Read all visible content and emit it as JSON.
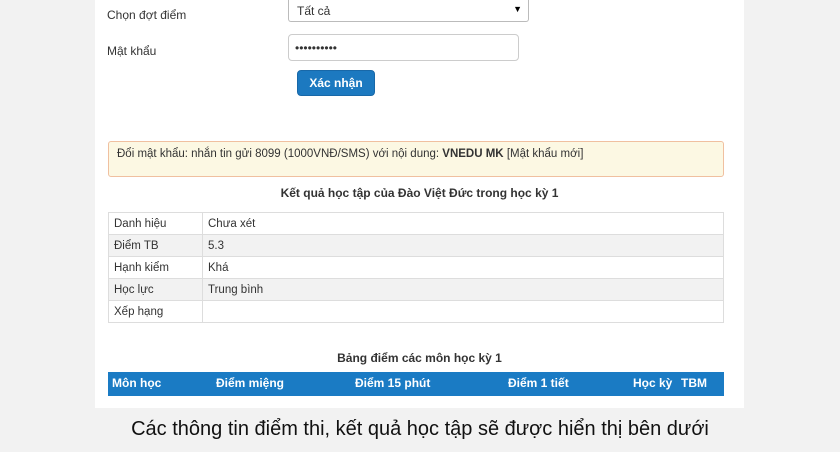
{
  "form": {
    "period_label": "Chọn đợt điểm",
    "period_value": "Tất cả",
    "password_label": "Mật khẩu",
    "password_value": "••••••••••",
    "submit_label": "Xác nhận"
  },
  "notice": {
    "text": "Đổi mật khẩu: nhắn tin gửi 8099 (1000VNĐ/SMS) với nội dung: ",
    "code": "VNEDU MK",
    "suffix": " [Mật khẩu mới]"
  },
  "results": {
    "title": "Kết quả học tập của Đào Việt Đức trong học kỳ 1",
    "rows": [
      {
        "key": "Danh hiệu",
        "value": "Chưa xét"
      },
      {
        "key": "Điểm TB",
        "value": "5.3"
      },
      {
        "key": "Hạnh kiểm",
        "value": "Khá"
      },
      {
        "key": "Học lực",
        "value": "Trung bình"
      },
      {
        "key": "Xếp hạng",
        "value": ""
      }
    ]
  },
  "grades": {
    "title": "Bảng điểm các môn học kỳ 1",
    "columns": [
      "Môn học",
      "Điểm miệng",
      "Điểm 15 phút",
      "Điểm 1 tiết",
      "Học kỳ",
      "TBM"
    ]
  },
  "caption": "Các thông tin điểm thi, kết quả học tập sẽ được hiển thị bên dưới"
}
